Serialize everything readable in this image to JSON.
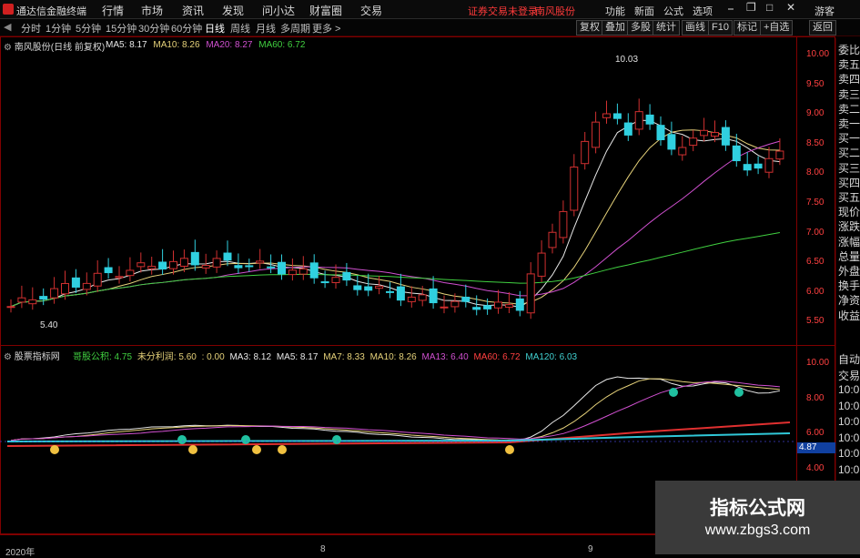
{
  "menubar": {
    "app_name": "通达信金融终端",
    "items": [
      "行情",
      "市场",
      "资讯",
      "发现",
      "问小达",
      "财富圈",
      "交易"
    ],
    "status_notice": "证券交易未登录",
    "stock_name": "南风股份",
    "right_items": [
      "功能",
      "新面",
      "公式",
      "选项"
    ],
    "guest": "游客"
  },
  "period_tabs": [
    "分时",
    "1分钟",
    "5分钟",
    "15分钟",
    "30分钟",
    "60分钟",
    "日线",
    "周线",
    "月线",
    "多周期",
    "更多 >"
  ],
  "active_tab": "日线",
  "toolbar_buttons": [
    "复权",
    "叠加",
    "多股",
    "统计",
    "画线",
    "F10",
    "标记",
    "+自选",
    "返回"
  ],
  "main_chart": {
    "title": "南风股份(日线 前复权)",
    "ma": [
      {
        "label": "MA5: 8.17",
        "color": "#e8e8e8"
      },
      {
        "label": "MA10: 8.26",
        "color": "#e6d27a"
      },
      {
        "label": "MA20: 8.27",
        "color": "#d050d0"
      },
      {
        "label": "MA60: 6.72",
        "color": "#40d040"
      }
    ],
    "y_ticks": [
      "10.00",
      "9.50",
      "9.00",
      "8.50",
      "8.00",
      "7.50",
      "7.00",
      "6.50",
      "6.00",
      "5.50"
    ],
    "high_label": "10.03",
    "low_label": "5.40"
  },
  "indicator": {
    "name": "股票指标网",
    "items": [
      {
        "label": "哥股公积: 4.75",
        "color": "#40d040"
      },
      {
        "label": "未分利润: 5.60",
        "color": "#e6d27a"
      },
      {
        "label": ": 0.00",
        "color": "#e6d27a"
      },
      {
        "label": "MA3: 8.12",
        "color": "#e8e8e8"
      },
      {
        "label": "MA5: 8.17",
        "color": "#e8e8e8"
      },
      {
        "label": "MA7: 8.33",
        "color": "#e6d27a"
      },
      {
        "label": "MA10: 8.26",
        "color": "#e6d27a"
      },
      {
        "label": "MA13: 6.40",
        "color": "#d050d0"
      },
      {
        "label": "MA60: 6.72",
        "color": "#ff4040"
      },
      {
        "label": "MA120: 6.03",
        "color": "#40d0d0"
      }
    ],
    "y_ticks": [
      "10.00",
      "8.00",
      "6.00",
      "4.00"
    ],
    "current_value": "4.87"
  },
  "sidebar_top": [
    "委比",
    "卖五",
    "卖四",
    "卖三",
    "卖二",
    "卖一",
    "买一",
    "买二",
    "买三",
    "买四",
    "买五",
    "现价",
    "涨跌",
    "涨幅",
    "总量",
    "外盘",
    "换手",
    "净资",
    "收益"
  ],
  "sidebar_bottom": [
    "自动",
    "交易",
    "10:0",
    "10:0",
    "10:0",
    "10:0",
    "10:0",
    "10:0",
    "10:0",
    "10:0",
    "10:0"
  ],
  "date_axis": [
    "2020年",
    "8",
    "9"
  ],
  "watermark": {
    "line1": "指标公式网",
    "line2": "www.zbgs3.com"
  },
  "colors": {
    "up": "#d03030",
    "down": "#30d0e0",
    "background": "#000000",
    "frame": "#800000"
  }
}
